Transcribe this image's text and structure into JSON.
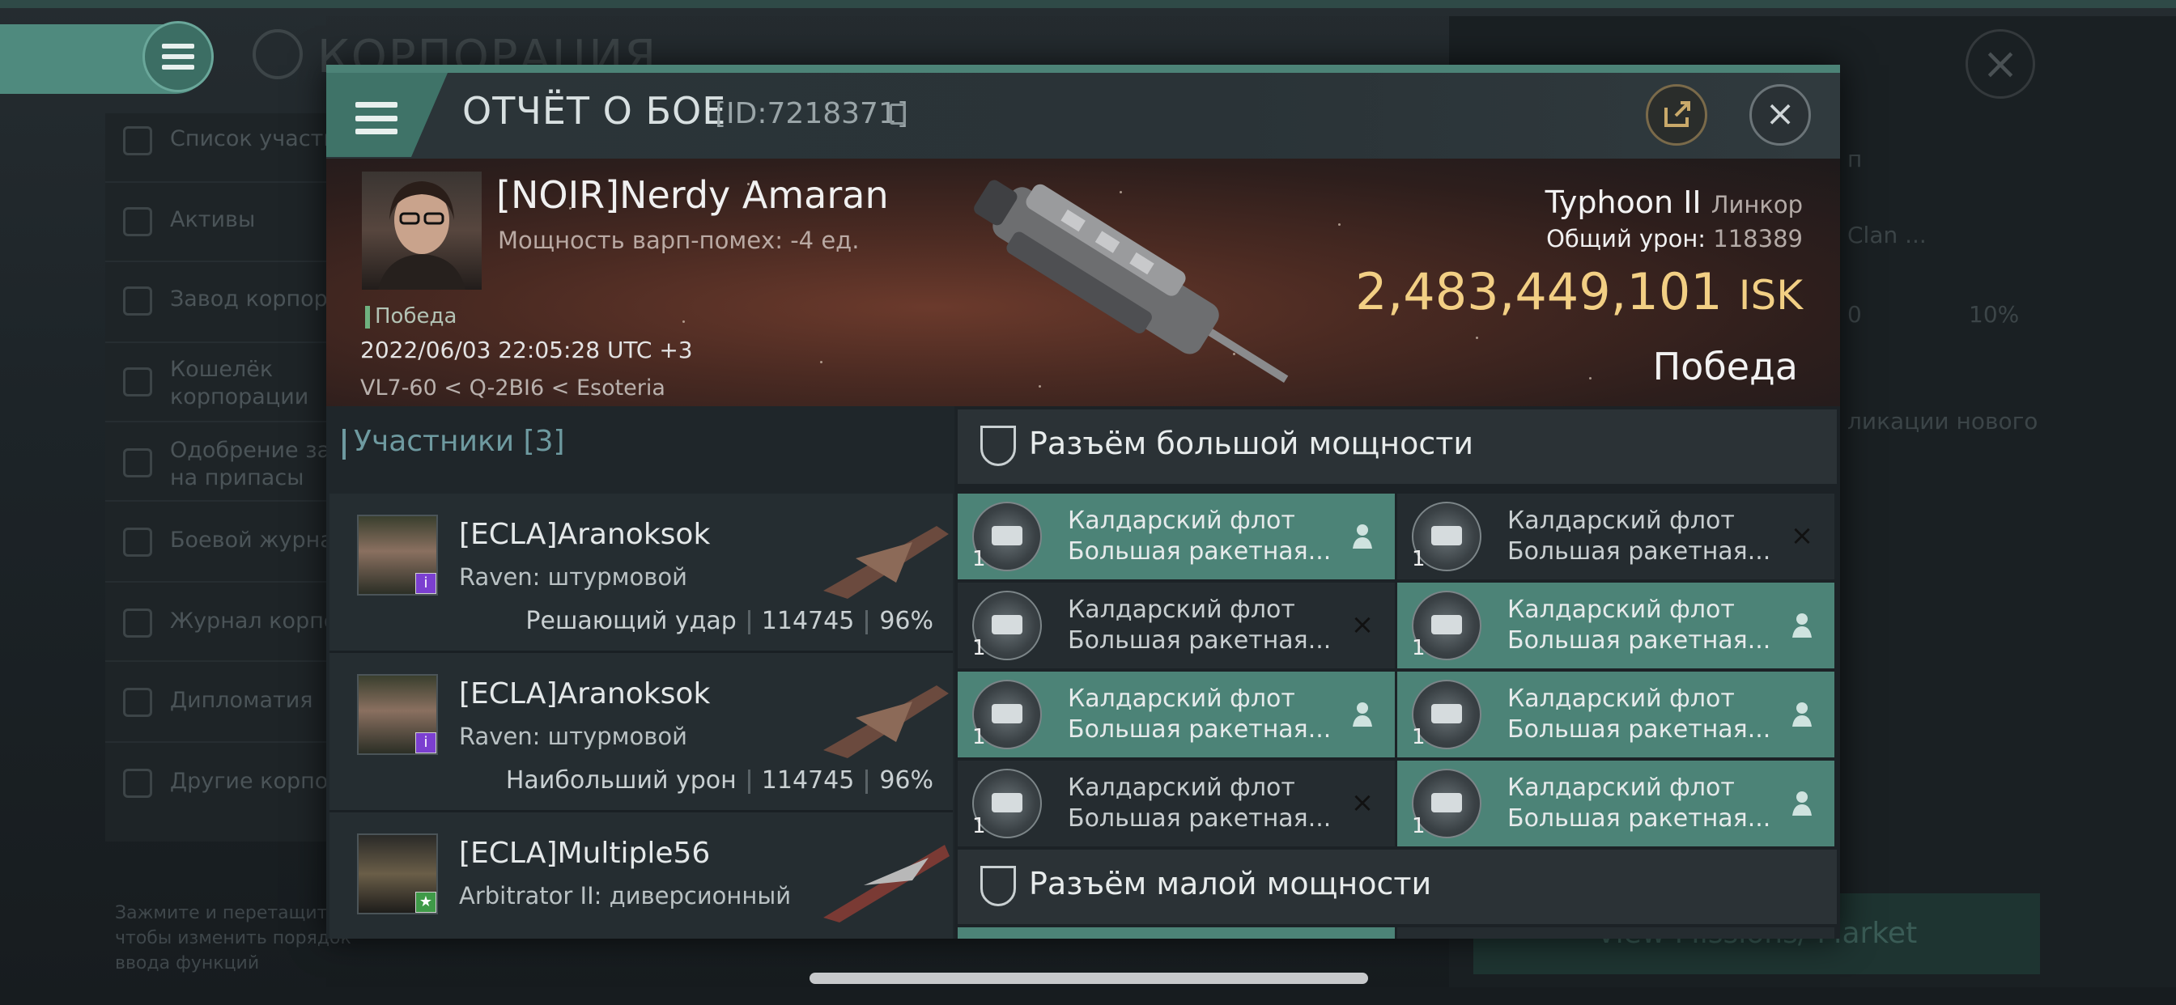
{
  "background": {
    "title": "КОРПОРАЦИЯ",
    "sidebar": [
      {
        "label": "Список участн"
      },
      {
        "label": "Активы"
      },
      {
        "label": "Завод корпора"
      },
      {
        "label": "Кошелёк\nкорпорации"
      },
      {
        "label": "Одобрение зая\nна припасы"
      },
      {
        "label": "Боевой журнал"
      },
      {
        "label": "Журнал корпор"
      },
      {
        "label": "Дипломатия"
      },
      {
        "label": "Другие корпор"
      }
    ],
    "hint": "Зажмите и перетащите, чтобы изменить порядок ввода функций",
    "market": "View Missions/ Market",
    "ghost_clan": "Clan ...",
    "ghost_zero": "0",
    "ghost_pct": "10%",
    "ghost_new": "ликации нового",
    "ghost_p": "п"
  },
  "dialog": {
    "title": "ОТЧЁТ О БОЕ",
    "id": "[ID:7218371]",
    "pilot": "[NOIR]Nerdy Amaran",
    "warp": "Мощность варп-помех: -4 ед.",
    "victory_small": "Победа",
    "datetime": "2022/06/03 22:05:28 UTC +3",
    "location": "VL7-60 < Q-2BI6 < Esoteria",
    "ship_name": "Typhoon II",
    "ship_class": "Линкор",
    "total_damage_label": "Общий урон:",
    "total_damage": "118389",
    "isk_value": "2,483,449,101",
    "isk_unit": "ISK",
    "result": "Победа"
  },
  "participants": {
    "header": "Участники [3]",
    "rows": [
      {
        "name": "[ECLA]Aranoksok",
        "ship": "Raven: штурмовой",
        "role": "Решающий удар",
        "damage": "114745",
        "pct": "96%",
        "badge": "i"
      },
      {
        "name": "[ECLA]Aranoksok",
        "ship": "Raven: штурмовой",
        "role": "Наибольший урон",
        "damage": "114745",
        "pct": "96%",
        "badge": "i"
      },
      {
        "name": "[ECLA]Multiple56",
        "ship": "Arbitrator II: диверсионный",
        "role": "",
        "damage": "",
        "pct": "",
        "badge": "★"
      }
    ]
  },
  "modules": {
    "high_title": "Разъём большой мощности",
    "low_title": "Разъём малой мощности",
    "items": [
      {
        "line1": "Калдарский флот",
        "line2": "Большая ракетная...",
        "qty": "1",
        "state": "dropped"
      },
      {
        "line1": "Калдарский флот",
        "line2": "Большая ракетная...",
        "qty": "1",
        "state": "destroyed"
      },
      {
        "line1": "Калдарский флот",
        "line2": "Большая ракетная...",
        "qty": "1",
        "state": "destroyed"
      },
      {
        "line1": "Калдарский флот",
        "line2": "Большая ракетная...",
        "qty": "1",
        "state": "dropped"
      },
      {
        "line1": "Калдарский флот",
        "line2": "Большая ракетная...",
        "qty": "1",
        "state": "dropped"
      },
      {
        "line1": "Калдарский флот",
        "line2": "Большая ракетная...",
        "qty": "1",
        "state": "dropped"
      },
      {
        "line1": "Калдарский флот",
        "line2": "Большая ракетная...",
        "qty": "1",
        "state": "destroyed"
      },
      {
        "line1": "Калдарский флот",
        "line2": "Большая ракетная...",
        "qty": "1",
        "state": "dropped"
      }
    ]
  },
  "colors": {
    "accent": "#4c8377",
    "isk": "#f2cf84",
    "panel": "#252c30"
  }
}
